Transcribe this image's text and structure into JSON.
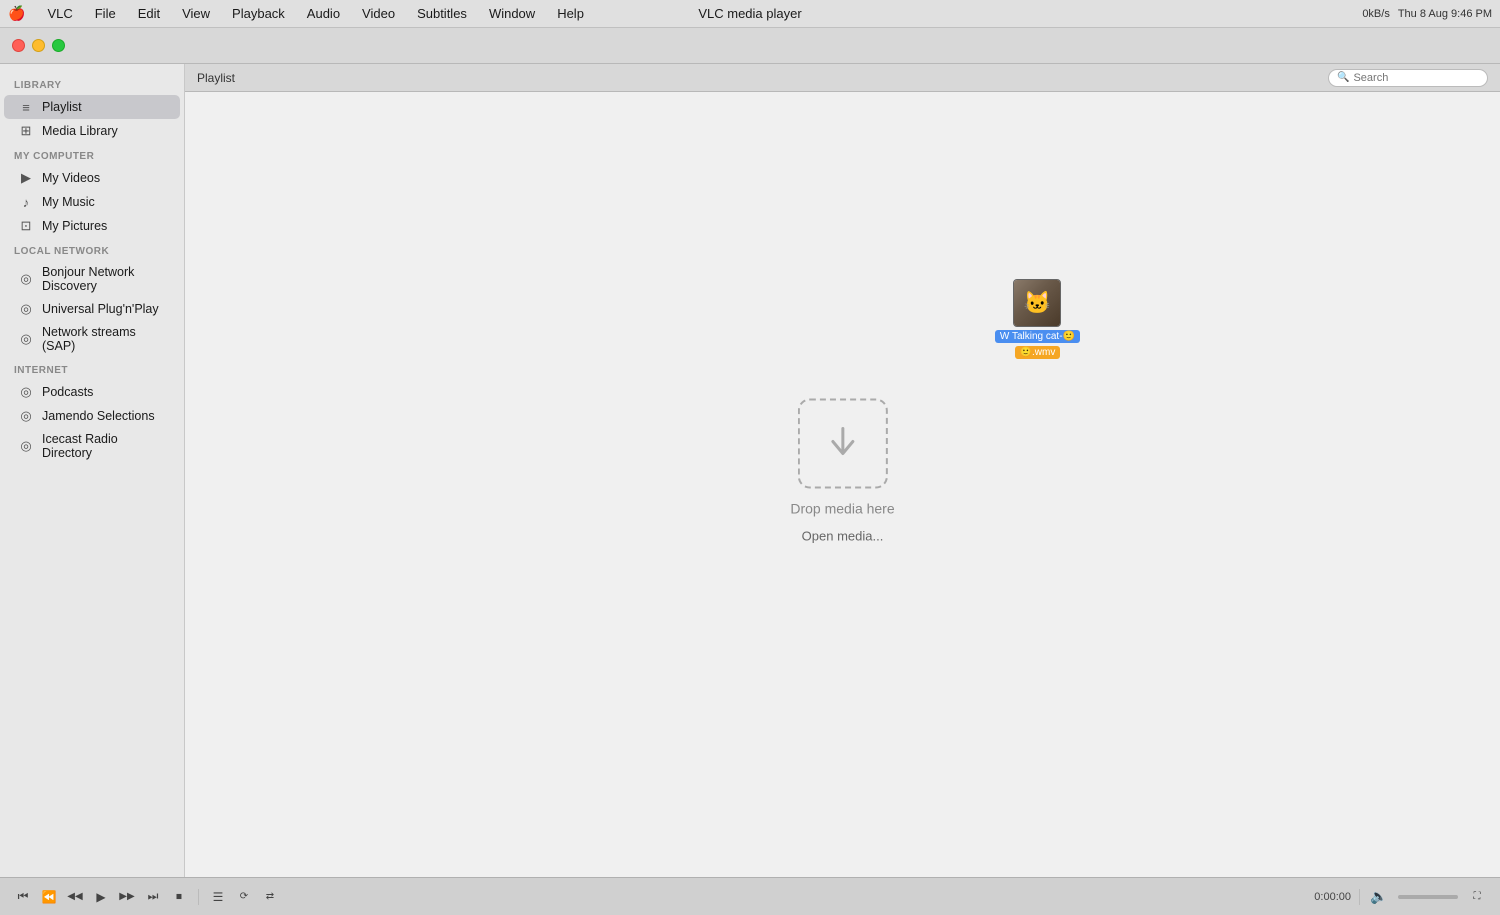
{
  "menubar": {
    "apple": "🍎",
    "app_name": "VLC",
    "menus": [
      "File",
      "Edit",
      "View",
      "Playback",
      "Audio",
      "Video",
      "Subtitles",
      "Window",
      "Help"
    ],
    "title": "VLC media player",
    "right": {
      "speed": "0kB/s",
      "time": "Thu 8 Aug  9:46 PM"
    }
  },
  "sidebar": {
    "library_label": "LIBRARY",
    "my_computer_label": "MY COMPUTER",
    "local_network_label": "LOCAL NETWORK",
    "internet_label": "INTERNET",
    "library_items": [
      {
        "id": "playlist",
        "label": "Playlist",
        "icon": "≡",
        "active": true
      },
      {
        "id": "media-library",
        "label": "Media Library",
        "icon": "⊞"
      }
    ],
    "computer_items": [
      {
        "id": "my-videos",
        "label": "My Videos",
        "icon": "▶"
      },
      {
        "id": "my-music",
        "label": "My Music",
        "icon": "♪"
      },
      {
        "id": "my-pictures",
        "label": "My Pictures",
        "icon": "⊡"
      }
    ],
    "network_items": [
      {
        "id": "bonjour",
        "label": "Bonjour Network Discovery",
        "icon": "◎"
      },
      {
        "id": "upnp",
        "label": "Universal Plug'n'Play",
        "icon": "◎"
      },
      {
        "id": "sap",
        "label": "Network streams (SAP)",
        "icon": "◎"
      }
    ],
    "internet_items": [
      {
        "id": "podcasts",
        "label": "Podcasts",
        "icon": "◎"
      },
      {
        "id": "jamendo",
        "label": "Jamendo Selections",
        "icon": "◎"
      },
      {
        "id": "icecast",
        "label": "Icecast Radio Directory",
        "icon": "◎"
      }
    ]
  },
  "playlist": {
    "header_label": "Playlist",
    "search_placeholder": "Search"
  },
  "dropzone": {
    "text": "Drop media here",
    "open_link": "Open media..."
  },
  "dragged_file": {
    "thumbnail_emoji": "🐱",
    "label": "W Talking cat-🙂",
    "ext": "🙂.wmv"
  },
  "controls": {
    "time": "0:00:00",
    "buttons": [
      "⏮",
      "⏪",
      "⏭",
      "▶",
      "⏩",
      "⏭",
      "⏹",
      "☰",
      "🔄",
      "🔀"
    ]
  }
}
